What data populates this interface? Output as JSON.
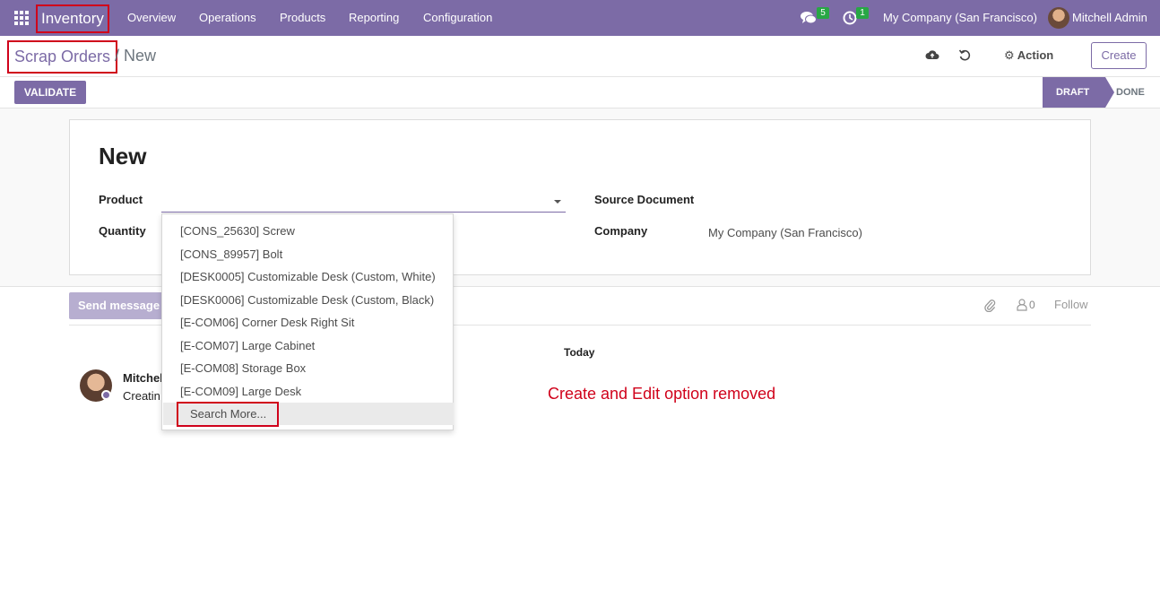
{
  "navbar": {
    "app_name": "Inventory",
    "menu": [
      "Overview",
      "Operations",
      "Products",
      "Reporting",
      "Configuration"
    ],
    "messages_count": "5",
    "activities_count": "1",
    "company": "My Company (San Francisco)",
    "user": "Mitchell Admin"
  },
  "control_panel": {
    "breadcrumb_parent": "Scrap Orders",
    "breadcrumb_current": "/ New",
    "action_label": "Action",
    "create_label": "Create"
  },
  "statusbar": {
    "validate_label": "VALIDATE",
    "stages": [
      "DRAFT",
      "DONE"
    ],
    "current_stage": "DRAFT"
  },
  "form": {
    "title": "New",
    "product_label": "Product",
    "product_value": "",
    "quantity_label": "Quantity",
    "source_document_label": "Source Document",
    "company_label": "Company",
    "company_value": "My Company (San Francisco)"
  },
  "product_dropdown": {
    "items": [
      "[CONS_25630] Screw",
      "[CONS_89957] Bolt",
      "[DESK0005] Customizable Desk (Custom, White)",
      "[DESK0006] Customizable Desk (Custom, Black)",
      "[E-COM06] Corner Desk Right Sit",
      "[E-COM07] Large Cabinet",
      "[E-COM08] Storage Box",
      "[E-COM09] Large Desk"
    ],
    "search_more": "Search More..."
  },
  "chatter": {
    "send_message_label": "Send message",
    "followers_count": "0",
    "follow_label": "Follow",
    "date_separator": "Today",
    "message_author": "Mitchel",
    "message_body": "Creatin"
  },
  "annotation": "Create and Edit option removed",
  "colors": {
    "brand": "#7c6ba6",
    "highlight_box": "#d0021b",
    "badge": "#28a745"
  }
}
